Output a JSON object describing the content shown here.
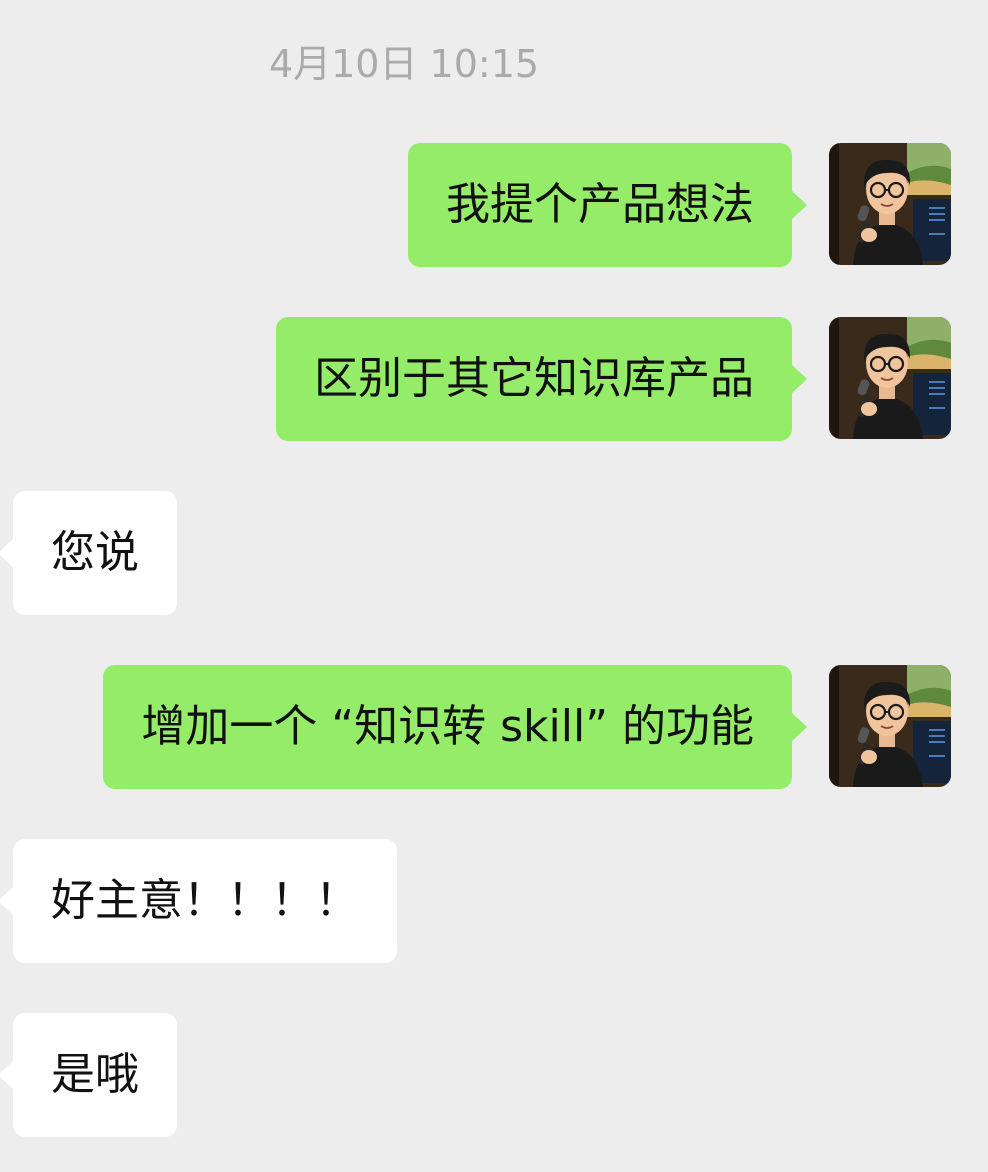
{
  "chat": {
    "timestamp": "4月10日 10:15",
    "messages": [
      {
        "side": "outgoing",
        "text": "我提个产品想法"
      },
      {
        "side": "outgoing",
        "text": "区别于其它知识库产品"
      },
      {
        "side": "incoming",
        "text": "您说"
      },
      {
        "side": "outgoing",
        "text": "增加一个 “知识转 skill” 的功能"
      },
      {
        "side": "incoming",
        "text": "好主意！！！！"
      },
      {
        "side": "incoming",
        "text": "是哦"
      }
    ]
  },
  "avatar_icon": "user-avatar-man-with-microphone-icon",
  "colors": {
    "background": "#ededed",
    "outgoing_bubble": "#95ec69",
    "incoming_bubble": "#ffffff",
    "timestamp_text": "#aaaaaa"
  }
}
